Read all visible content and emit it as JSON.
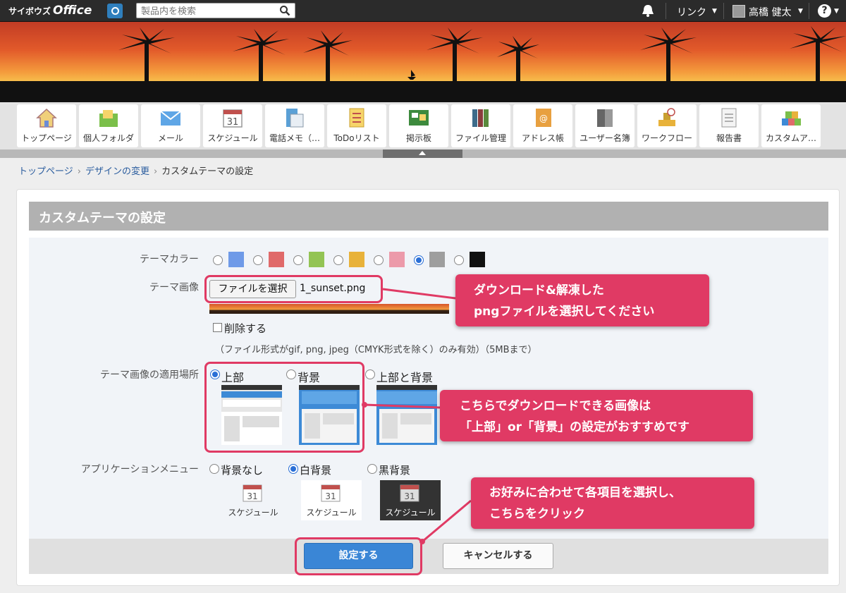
{
  "header": {
    "brand_small": "サイボウズ",
    "brand_big": "Office",
    "search_placeholder": "製品内を検索",
    "link_menu": "リンク",
    "user_name": "高橋 健太",
    "help_label": "?"
  },
  "apps": [
    {
      "label": "トップページ",
      "icon": "home-icon"
    },
    {
      "label": "個人フォルダ",
      "icon": "folder-icon"
    },
    {
      "label": "メール",
      "icon": "mail-icon"
    },
    {
      "label": "スケジュール",
      "icon": "calendar-icon"
    },
    {
      "label": "電話メモ（…",
      "icon": "phone-memo-icon"
    },
    {
      "label": "ToDoリスト",
      "icon": "todo-icon"
    },
    {
      "label": "掲示板",
      "icon": "board-icon"
    },
    {
      "label": "ファイル管理",
      "icon": "file-icon"
    },
    {
      "label": "アドレス帳",
      "icon": "address-book-icon"
    },
    {
      "label": "ユーザー名簿",
      "icon": "user-list-icon"
    },
    {
      "label": "ワークフロー",
      "icon": "workflow-icon"
    },
    {
      "label": "報告書",
      "icon": "report-icon"
    },
    {
      "label": "カスタムア…",
      "icon": "custom-app-icon"
    }
  ],
  "breadcrumb": {
    "item1": "トップページ",
    "item2": "デザインの変更",
    "current": "カスタムテーマの設定"
  },
  "page_title": "カスタムテーマの設定",
  "form": {
    "theme_color_label": "テーマカラー",
    "theme_colors": [
      {
        "hex": "#6f9ae8",
        "selected": false
      },
      {
        "hex": "#e06a6a",
        "selected": false
      },
      {
        "hex": "#93c454",
        "selected": false
      },
      {
        "hex": "#e8b23a",
        "selected": false
      },
      {
        "hex": "#ec9aaa",
        "selected": false
      },
      {
        "hex": "#9e9e9e",
        "selected": true
      },
      {
        "hex": "#111111",
        "selected": false
      }
    ],
    "theme_image_label": "テーマ画像",
    "file_button": "ファイルを選択",
    "file_name": "1_sunset.png",
    "delete_label": "削除する",
    "format_note": "（ファイル形式がgif, png, jpeg（CMYK形式を除く）のみ有効）（5MBまで）",
    "placement_label": "テーマ画像の適用場所",
    "placement_options": [
      {
        "label": "上部",
        "selected": true
      },
      {
        "label": "背景",
        "selected": false
      },
      {
        "label": "上部と背景",
        "selected": false
      }
    ],
    "menu_label": "アプリケーションメニュー",
    "menu_options": [
      {
        "label": "背景なし",
        "selected": false,
        "preview": "スケジュール"
      },
      {
        "label": "白背景",
        "selected": true,
        "preview": "スケジュール"
      },
      {
        "label": "黒背景",
        "selected": false,
        "preview": "スケジュール"
      }
    ],
    "submit": "設定する",
    "cancel": "キャンセルする"
  },
  "callouts": {
    "c1_line1": "ダウンロード&解凍した",
    "c1_line2": "pngファイルを選択してください",
    "c2_line1": "こちらでダウンロードできる画像は",
    "c2_line2": "「上部」or「背景」の設定がおすすめです",
    "c3_line1": "お好みに合わせて各項目を選択し、",
    "c3_line2": "こちらをクリック"
  },
  "colors": {
    "accent": "#e03a64",
    "primary_button": "#3a86d6",
    "topbar": "#2b2b2b"
  }
}
